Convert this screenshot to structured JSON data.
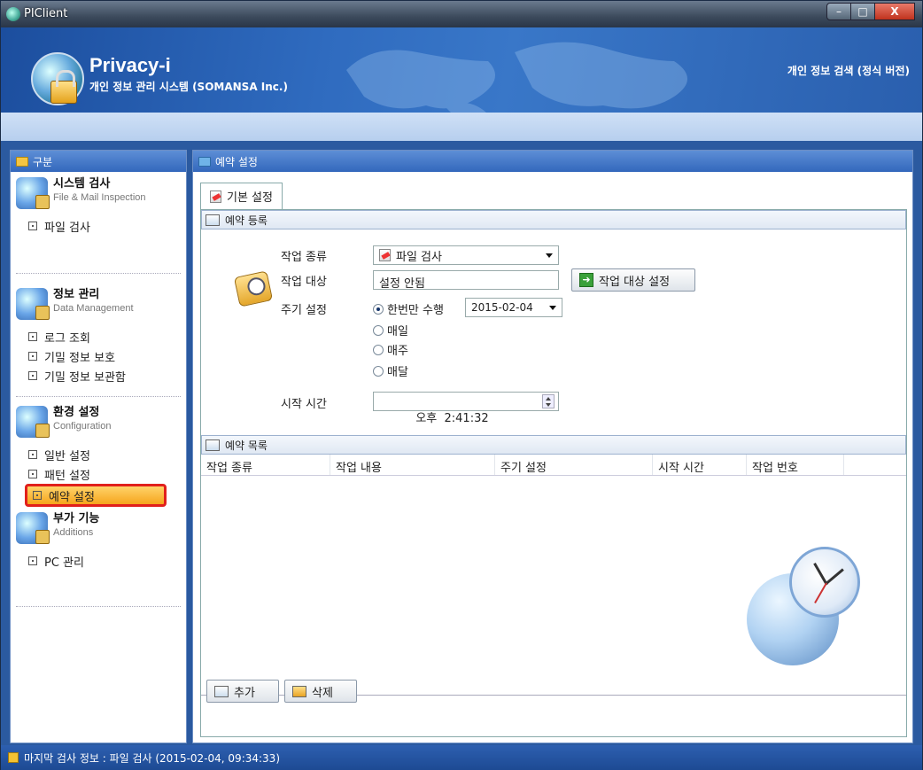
{
  "window": {
    "title": "PIClient",
    "min": "–",
    "max": "□",
    "close": "X"
  },
  "header": {
    "brand": "Privacy-i",
    "subtitle": "개인 정보 관리 시스템 (SOMANSA Inc.)",
    "edition": "개인 정보 검색 (정식 버전)"
  },
  "sidebar": {
    "title": "구분",
    "sections": [
      {
        "title": "시스템 검사",
        "subtitle": "File & Mail Inspection",
        "items": [
          "파일 검사"
        ]
      },
      {
        "title": "정보 관리",
        "subtitle": "Data Management",
        "items": [
          "로그 조회",
          "기밀 정보 보호",
          "기밀 정보 보관함"
        ]
      },
      {
        "title": "환경 설정",
        "subtitle": "Configuration",
        "items": [
          "일반 설정",
          "패턴 설정",
          "예약 설정"
        ]
      },
      {
        "title": "부가 기능",
        "subtitle": "Additions",
        "items": [
          "PC 관리"
        ]
      }
    ],
    "active_item": "예약 설정"
  },
  "main": {
    "title": "예약 설정",
    "tab": "기본 설정",
    "reg_group": "예약 등록",
    "form": {
      "job_type_label": "작업 종류",
      "job_type_value": "파일 검사",
      "target_label": "작업 대상",
      "target_value": "설정 안됨",
      "target_button": "작업 대상 설정",
      "cycle_label": "주기 설정",
      "cycle_options": [
        "한번만 수행",
        "매일",
        "매주",
        "매달"
      ],
      "cycle_selected": "한번만 수행",
      "date_value": "2015-02-04",
      "start_label": "시작 시간",
      "start_value": "오후  2:41:32"
    },
    "list_group": "예약 목록",
    "columns": [
      "작업 종류",
      "작업 내용",
      "주기 설정",
      "시작 시간",
      "작업 번호"
    ],
    "rows": [],
    "add_button": "추가",
    "delete_button": "삭제"
  },
  "status": {
    "text": "마지막 검사 정보 : 파일 검사 (2015-02-04, 09:34:33)"
  },
  "colors": {
    "accent": "#2b5aa0",
    "highlight": "#f6a51c",
    "selection_border": "#e1201c"
  }
}
